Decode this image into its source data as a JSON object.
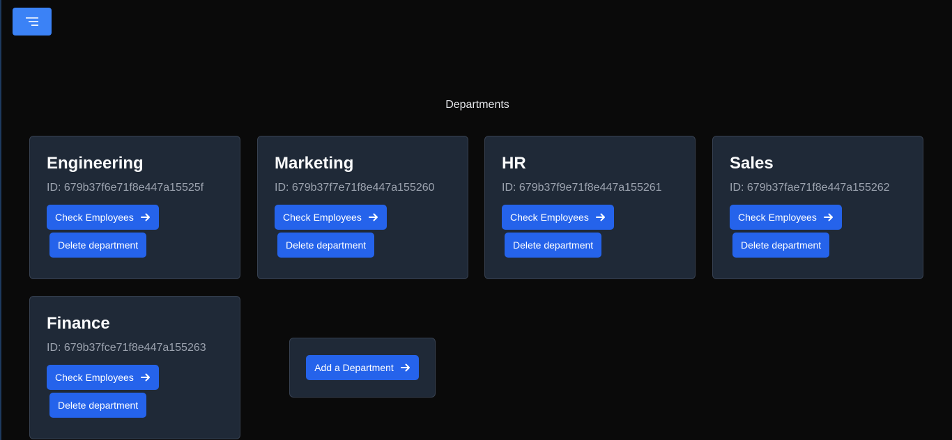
{
  "header": {
    "menu_icon": "menu-icon"
  },
  "page": {
    "title": "Departments"
  },
  "departments": [
    {
      "name": "Engineering",
      "id_text": "ID: 679b37f6e71f8e447a15525f",
      "check_label": "Check Employees",
      "delete_label": "Delete department"
    },
    {
      "name": "Marketing",
      "id_text": "ID: 679b37f7e71f8e447a155260",
      "check_label": "Check Employees",
      "delete_label": "Delete department"
    },
    {
      "name": "HR",
      "id_text": "ID: 679b37f9e71f8e447a155261",
      "check_label": "Check Employees",
      "delete_label": "Delete department"
    },
    {
      "name": "Sales",
      "id_text": "ID: 679b37fae71f8e447a155262",
      "check_label": "Check Employees",
      "delete_label": "Delete department"
    },
    {
      "name": "Finance",
      "id_text": "ID: 679b37fce71f8e447a155263",
      "check_label": "Check Employees",
      "delete_label": "Delete department"
    }
  ],
  "add": {
    "label": "Add a Department"
  },
  "colors": {
    "accent": "#2563eb",
    "card_bg": "#1f2937",
    "page_bg": "#0a0a0a"
  }
}
